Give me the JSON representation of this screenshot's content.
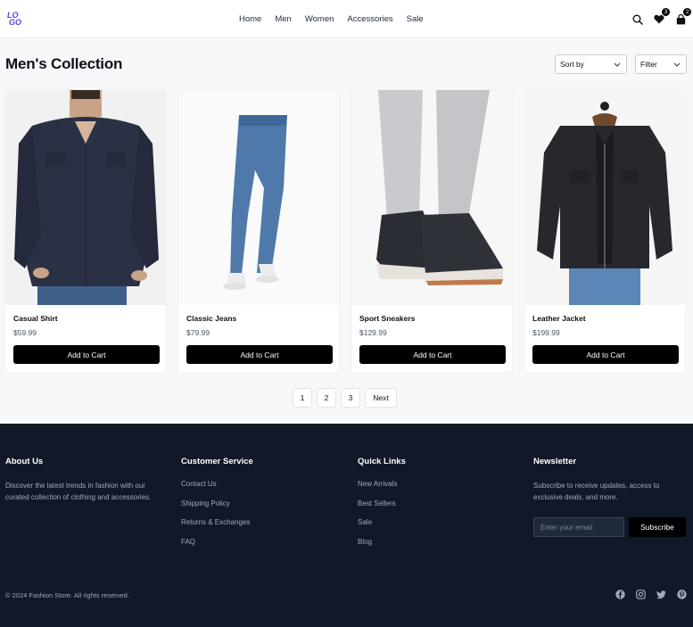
{
  "header": {
    "logo_text": "LOGO",
    "nav": [
      "Home",
      "Men",
      "Women",
      "Accessories",
      "Sale"
    ],
    "wishlist_count": "3",
    "cart_count": "2"
  },
  "page": {
    "title": "Men's Collection",
    "sort_label": "Sort by",
    "filter_label": "Filter"
  },
  "products": [
    {
      "name": "Casual Shirt",
      "price": "$59.99",
      "button": "Add to Cart",
      "image": "navy-shirt-photo"
    },
    {
      "name": "Classic Jeans",
      "price": "$79.99",
      "button": "Add to Cart",
      "image": "jeans-photo"
    },
    {
      "name": "Sport Sneakers",
      "price": "$129.99",
      "button": "Add to Cart",
      "image": "sneakers-photo"
    },
    {
      "name": "Leather Jacket",
      "price": "$199.99",
      "button": "Add to Cart",
      "image": "jacket-photo"
    }
  ],
  "pagination": [
    "1",
    "2",
    "3",
    "Next"
  ],
  "footer": {
    "about": {
      "title": "About Us",
      "text": "Discover the latest trends in fashion with our curated collection of clothing and accessories."
    },
    "service": {
      "title": "Customer Service",
      "links": [
        "Contact Us",
        "Shipping Policy",
        "Returns & Exchanges",
        "FAQ"
      ]
    },
    "quick": {
      "title": "Quick Links",
      "links": [
        "New Arrivals",
        "Best Sellers",
        "Sale",
        "Blog"
      ]
    },
    "newsletter": {
      "title": "Newsletter",
      "text": "Subscribe to receive updates, access to exclusive deals, and more.",
      "placeholder": "Enter your email",
      "button": "Subscribe"
    },
    "copyright": "© 2024 Fashion Store. All rights reserved.",
    "social": [
      "facebook-icon",
      "instagram-icon",
      "twitter-icon",
      "pinterest-icon"
    ]
  },
  "colors": {
    "accent": "#4f46e5",
    "footer_bg": "#111827",
    "button_bg": "#000000"
  }
}
